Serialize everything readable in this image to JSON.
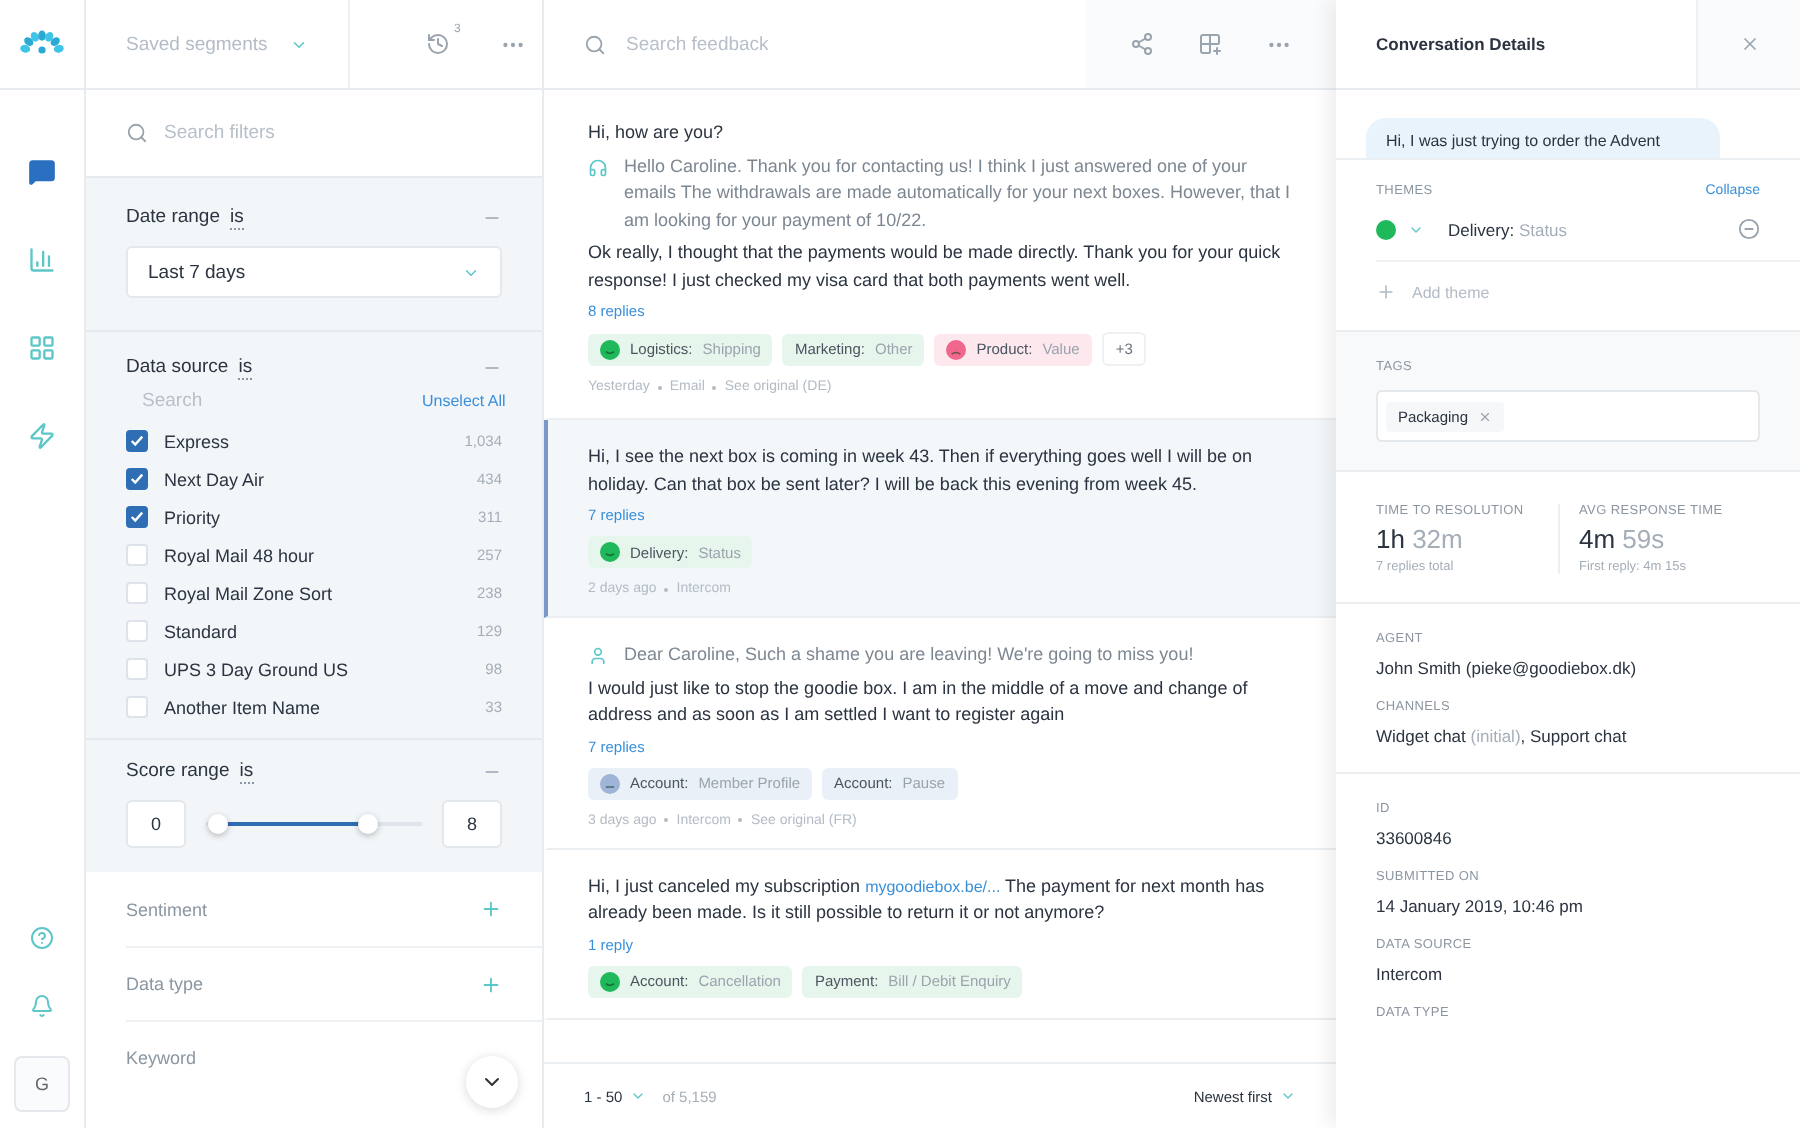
{
  "rail": {
    "nav": [
      {
        "kind": "chat",
        "selected": true
      },
      {
        "kind": "chart",
        "selected": false
      },
      {
        "kind": "grid",
        "selected": false
      },
      {
        "kind": "zap",
        "selected": false
      }
    ],
    "avatar": "G"
  },
  "filters": {
    "segments": {
      "placeholder": "Saved segments"
    },
    "history_count": "3",
    "search": {
      "placeholder": "Search filters"
    },
    "date_range": {
      "label": "Date range",
      "operator": "is",
      "value": "Last 7 days"
    },
    "data_source": {
      "label": "Data source",
      "operator": "is",
      "search_placeholder": "Search",
      "unselect": "Unselect All",
      "options": [
        {
          "name": "Express",
          "count": "1,034",
          "checked": true
        },
        {
          "name": "Next Day Air",
          "count": "434",
          "checked": true
        },
        {
          "name": "Priority",
          "count": "311",
          "checked": true
        },
        {
          "name": "Royal Mail 48 hour",
          "count": "257",
          "checked": false
        },
        {
          "name": "Royal Mail Zone Sort",
          "count": "238",
          "checked": false
        },
        {
          "name": "Standard",
          "count": "129",
          "checked": false
        },
        {
          "name": "UPS 3 Day Ground US",
          "count": "98",
          "checked": false
        },
        {
          "name": "Another Item Name",
          "count": "33",
          "checked": false
        }
      ]
    },
    "score_range": {
      "label": "Score range",
      "operator": "is",
      "min": "0",
      "max": "8",
      "thumbs": [
        {
          "level": 0
        },
        {
          "level": 0.78
        }
      ]
    },
    "collapsed": [
      {
        "label": "Sentiment",
        "addable": true
      },
      {
        "label": "Data type",
        "addable": true
      },
      {
        "label": "Keyword",
        "addable": false
      }
    ],
    "scroll_button": true
  },
  "feed": {
    "search": {
      "placeholder": "Search feedback"
    },
    "items": [
      {
        "selected": false,
        "messages": [
          {
            "kind": "customer",
            "parts": [
              {
                "text": "Hi, how are you?"
              }
            ]
          },
          {
            "kind": "agent-headset",
            "parts": [
              {
                "text": "Hello Caroline. Thank you for contacting us! I think I just answered one of your emails The withdrawals are made automatically for your next boxes. However, that I am looking for your payment of 10/22."
              }
            ]
          },
          {
            "kind": "customer",
            "parts": [
              {
                "text": "Ok really, I thought that the payments would be made directly. Thank you for your quick response! I just checked my visa card that both payments went well."
              }
            ]
          }
        ],
        "replies": "8 replies",
        "tags": [
          {
            "kind": "happy",
            "category": "Logistics:",
            "value": "Shipping",
            "color": "#e6f6ec"
          },
          {
            "kind": "plain",
            "category": "Marketing:",
            "value": "Other",
            "color": "#e6f6ec"
          },
          {
            "kind": "sad",
            "category": "Product:",
            "value": "Value",
            "color": "#fde8ee"
          }
        ],
        "more": "+3",
        "meta": [
          "Yesterday",
          "Email",
          "See original (DE)"
        ]
      },
      {
        "selected": true,
        "messages": [
          {
            "kind": "customer",
            "parts": [
              {
                "text": "Hi, I see the next box is coming in week 43. Then if everything goes well I will be on holiday. Can that box be sent later? I will be back this evening from week 45."
              }
            ]
          }
        ],
        "replies": "7 replies",
        "tags": [
          {
            "kind": "happy",
            "category": "Delivery:",
            "value": "Status",
            "color": "#e6f6ec"
          }
        ],
        "meta": [
          "2 days ago",
          "Intercom"
        ]
      },
      {
        "selected": false,
        "messages": [
          {
            "kind": "agent-person",
            "parts": [
              {
                "text": "Dear Caroline, Such a shame you are leaving! We're going to miss you!"
              }
            ]
          },
          {
            "kind": "customer",
            "parts": [
              {
                "text": "I would just like to stop the goodie box. I am in the middle of a move and change of address and as soon as I am settled I want to register again"
              }
            ]
          }
        ],
        "replies": "7 replies",
        "tags": [
          {
            "kind": "neutral",
            "category": "Account:",
            "value": "Member Profile",
            "color": "#eaf0f8"
          },
          {
            "kind": "plain",
            "category": "Account:",
            "value": "Pause",
            "color": "#eaf0f8"
          }
        ],
        "meta": [
          "3 days ago",
          "Intercom",
          "See original (FR)"
        ]
      },
      {
        "selected": false,
        "messages": [
          {
            "kind": "customer",
            "parts": [
              {
                "text": "Hi, I just canceled my subscription "
              },
              {
                "text": "mygoodiebox.be/...",
                "link": true
              },
              {
                "text": " The payment for next month has already been made. Is it still possible to return it or not anymore?"
              }
            ]
          }
        ],
        "replies": "1 reply",
        "tags": [
          {
            "kind": "happy",
            "category": "Account:",
            "value": "Cancellation",
            "color": "#e6f6ec"
          },
          {
            "kind": "plain",
            "category": "Payment:",
            "value": "Bill / Debit Enquiry",
            "color": "#e6f6ec"
          }
        ]
      }
    ],
    "footer": {
      "range": "1 - 50",
      "total": "of 5,159",
      "sort": "Newest first"
    }
  },
  "details": {
    "title": "Conversation Details",
    "bubble": "Hi, I was just trying to order the Advent",
    "themes": {
      "label": "THEMES",
      "action": "Collapse",
      "items": [
        {
          "category": "Delivery:",
          "value": "Status",
          "color": "#1fb85a"
        }
      ],
      "add": "Add theme"
    },
    "tags": {
      "label": "TAGS",
      "items": [
        "Packaging"
      ]
    },
    "stats": [
      {
        "label": "TIME TO RESOLUTION",
        "parts": [
          {
            "text": "1h"
          },
          {
            "text": " 32m",
            "muted": true
          }
        ],
        "sub": "7 replies total"
      },
      {
        "label": "AVG RESPONSE TIME",
        "parts": [
          {
            "text": "4m"
          },
          {
            "text": " 59s",
            "muted": true
          }
        ],
        "sub": "First reply: 4m 15s"
      }
    ],
    "groups": [
      [
        {
          "label": "AGENT",
          "parts": [
            {
              "text": "John Smith (pieke@goodiebox.dk)"
            }
          ]
        },
        {
          "label": "CHANNELS",
          "parts": [
            {
              "text": "Widget chat "
            },
            {
              "text": "(initial)",
              "muted": true
            },
            {
              "text": ", Support chat"
            }
          ]
        }
      ],
      [
        {
          "label": "ID",
          "parts": [
            {
              "text": "33600846"
            }
          ]
        },
        {
          "label": "SUBMITTED ON",
          "parts": [
            {
              "text": "14 January 2019, 10:46 pm"
            }
          ]
        },
        {
          "label": "DATA SOURCE",
          "parts": [
            {
              "text": "Intercom"
            }
          ]
        },
        {
          "label": "DATA TYPE"
        }
      ]
    ]
  }
}
